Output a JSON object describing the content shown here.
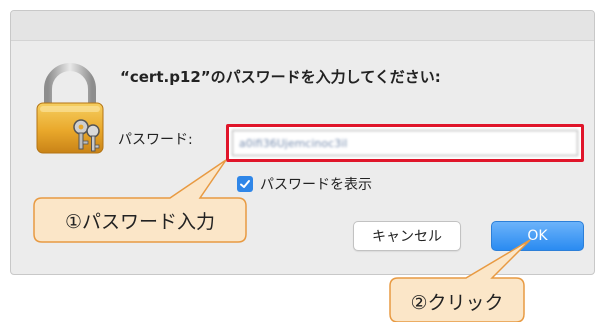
{
  "dialog": {
    "prompt": "“cert.p12”のパスワードを入力してください:",
    "password_label": "パスワード:",
    "password_value": "a0ifi36Ujemcinoc3il",
    "show_password_label": "パスワードを表示",
    "show_password_checked": true,
    "cancel_label": "キャンセル",
    "ok_label": "OK"
  },
  "annotations": {
    "step1": "①パスワード入力",
    "step2": "②クリック"
  },
  "colors": {
    "callout_fill": "#fbe6c8",
    "callout_border": "#e89a42",
    "highlight_border": "#e0152a",
    "accent_blue": "#2a8bf1"
  },
  "icons": [
    "lock-icon",
    "keys-icon",
    "checkmark-icon"
  ]
}
